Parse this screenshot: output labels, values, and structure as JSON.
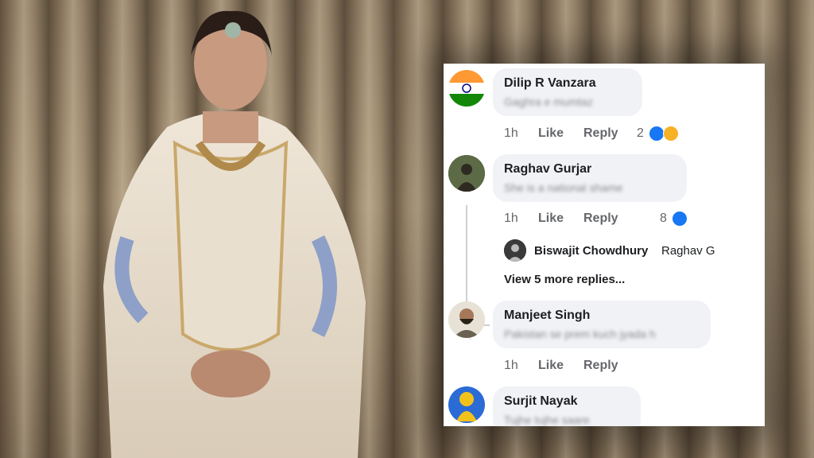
{
  "comments": [
    {
      "name": "Dilip R Vanzara",
      "text": "Gaghra e mumtaz",
      "time": "1h",
      "like": "Like",
      "reply": "Reply",
      "reaction_count": "2",
      "reactions": [
        "like-icon",
        "haha-icon"
      ]
    },
    {
      "name": "Raghav Gurjar",
      "text": "She is a national shame",
      "time": "1h",
      "like": "Like",
      "reply": "Reply",
      "reaction_count": "8",
      "reactions": [
        "like-icon"
      ],
      "replies": {
        "first_name": "Biswajit Chowdhury",
        "first_snippet": "Raghav G",
        "more_label": "View 5 more replies..."
      }
    },
    {
      "name": "Manjeet Singh",
      "text": "Pakistan se prem kuch jyada h",
      "time": "1h",
      "like": "Like",
      "reply": "Reply"
    },
    {
      "name": "Surjit Nayak",
      "text": "Tujhe tujhe saare"
    }
  ],
  "colors": {
    "like_blue": "#1877f2",
    "bubble": "#f0f2f5",
    "meta_gray": "#65676b"
  }
}
